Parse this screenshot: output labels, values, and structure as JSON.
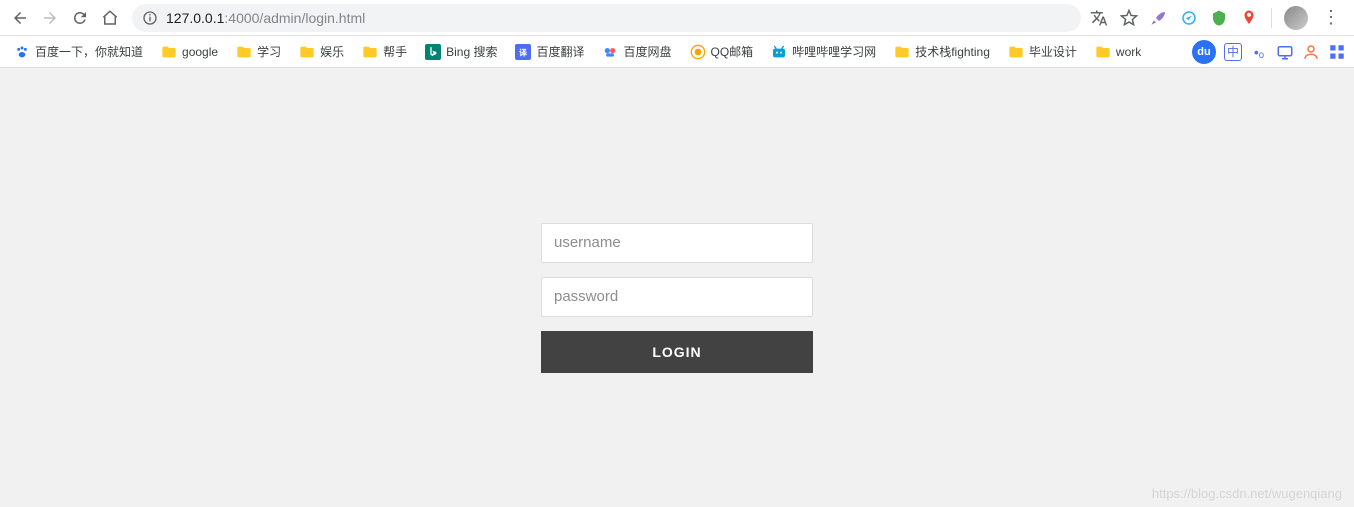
{
  "toolbar": {
    "url_host": "127.0.0.1",
    "url_path": ":4000/admin/login.html"
  },
  "bookmarks": [
    {
      "label": "百度一下，你就知道",
      "icon": "baidu-paw"
    },
    {
      "label": "google",
      "icon": "folder"
    },
    {
      "label": "学习",
      "icon": "folder"
    },
    {
      "label": "娱乐",
      "icon": "folder"
    },
    {
      "label": "帮手",
      "icon": "folder"
    },
    {
      "label": "Bing 搜索",
      "icon": "bing"
    },
    {
      "label": "百度翻译",
      "icon": "baidu-translate"
    },
    {
      "label": "百度网盘",
      "icon": "baidu-pan"
    },
    {
      "label": "QQ邮箱",
      "icon": "qqmail"
    },
    {
      "label": "哔哩哔哩学习网",
      "icon": "bilibili"
    },
    {
      "label": "技术栈fighting",
      "icon": "folder"
    },
    {
      "label": "毕业设计",
      "icon": "folder"
    },
    {
      "label": "work",
      "icon": "folder"
    }
  ],
  "rightIcons": {
    "du": "du",
    "zhong": "中",
    "dots": "•ₒ"
  },
  "login": {
    "username_placeholder": "username",
    "password_placeholder": "password",
    "button_label": "LOGIN"
  },
  "watermark": "https://blog.csdn.net/wugenqiang"
}
